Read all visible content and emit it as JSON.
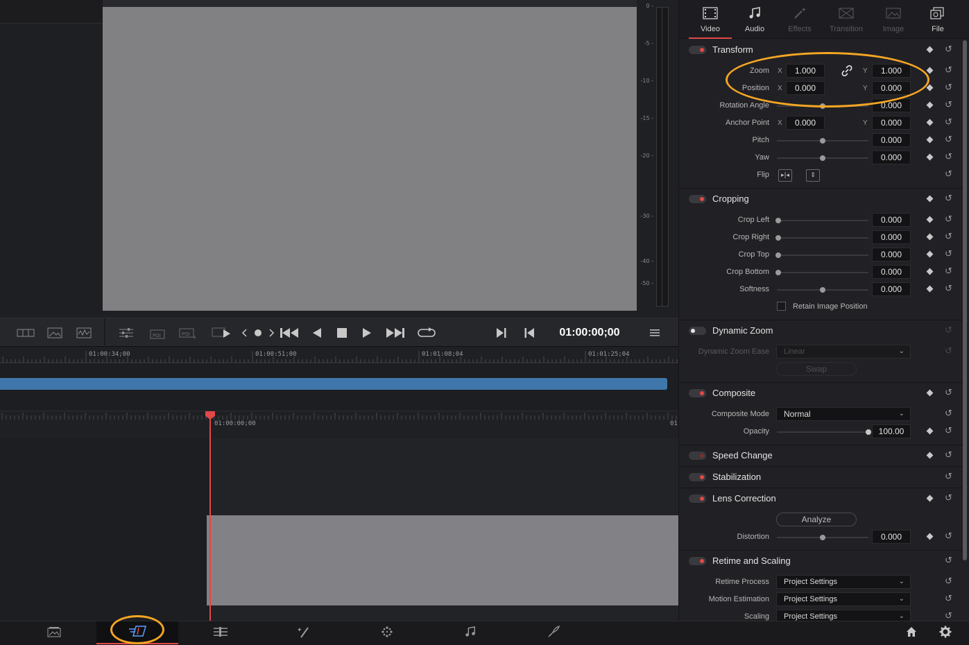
{
  "viewer": {
    "meter_ticks": [
      "0 -",
      "-5 -",
      "-10 -",
      "-15 -",
      "-20 -",
      "-30 -",
      "-40 -",
      "-50 -"
    ],
    "timecode": "01:00:00;00"
  },
  "timeline": {
    "ruler_top_labels": [
      "01:00:34;00",
      "01:00:51;00",
      "01:01:08;04",
      "01:01:25;04"
    ],
    "ruler_bottom_labels": [
      "01:00:00;00",
      "01"
    ]
  },
  "inspector": {
    "tabs": [
      {
        "label": "Video",
        "icon": "film-icon",
        "active": true
      },
      {
        "label": "Audio",
        "icon": "music-note-icon"
      },
      {
        "label": "Effects",
        "icon": "magic-wand-icon",
        "disabled": true
      },
      {
        "label": "Transition",
        "icon": "transition-icon",
        "disabled": true
      },
      {
        "label": "Image",
        "icon": "image-icon",
        "disabled": true
      },
      {
        "label": "File",
        "icon": "file-icon"
      }
    ],
    "transform": {
      "title": "Transform",
      "zoom_label": "Zoom",
      "zoom_x": "1.000",
      "zoom_y": "1.000",
      "position_label": "Position",
      "position_x": "0.000",
      "position_y": "0.000",
      "rotation_label": "Rotation Angle",
      "rotation": "0.000",
      "anchor_label": "Anchor Point",
      "anchor_x": "0.000",
      "anchor_y": "0.000",
      "pitch_label": "Pitch",
      "pitch": "0.000",
      "yaw_label": "Yaw",
      "yaw": "0.000",
      "flip_label": "Flip",
      "x_axis": "X",
      "y_axis": "Y"
    },
    "cropping": {
      "title": "Cropping",
      "crop_left_label": "Crop Left",
      "crop_left": "0.000",
      "crop_right_label": "Crop Right",
      "crop_right": "0.000",
      "crop_top_label": "Crop Top",
      "crop_top": "0.000",
      "crop_bottom_label": "Crop Bottom",
      "crop_bottom": "0.000",
      "softness_label": "Softness",
      "softness": "0.000",
      "retain_label": "Retain Image Position"
    },
    "dynamic_zoom": {
      "title": "Dynamic Zoom",
      "ease_label": "Dynamic Zoom Ease",
      "ease_value": "Linear",
      "swap_label": "Swap"
    },
    "composite": {
      "title": "Composite",
      "mode_label": "Composite Mode",
      "mode_value": "Normal",
      "opacity_label": "Opacity",
      "opacity": "100.00"
    },
    "speed_change": {
      "title": "Speed Change"
    },
    "stabilization": {
      "title": "Stabilization"
    },
    "lens_correction": {
      "title": "Lens Correction",
      "analyze_label": "Analyze",
      "distortion_label": "Distortion",
      "distortion": "0.000"
    },
    "retime": {
      "title": "Retime and Scaling",
      "process_label": "Retime Process",
      "process_value": "Project Settings",
      "motion_label": "Motion Estimation",
      "motion_value": "Project Settings",
      "scaling_label": "Scaling",
      "scaling_value": "Project Settings"
    }
  },
  "bottom_nav": [
    {
      "name": "media-page",
      "icon": "media-icon"
    },
    {
      "name": "cut-page",
      "icon": "cut-icon",
      "active": true
    },
    {
      "name": "edit-page",
      "icon": "edit-icon"
    },
    {
      "name": "fusion-page",
      "icon": "fusion-icon"
    },
    {
      "name": "color-page",
      "icon": "color-icon"
    },
    {
      "name": "fairlight-page",
      "icon": "music-note-icon"
    },
    {
      "name": "deliver-page",
      "icon": "rocket-icon"
    }
  ],
  "colors": {
    "accent_red": "#e24848",
    "highlight_orange": "#f5a623",
    "clip_blue": "#3f77ab"
  }
}
